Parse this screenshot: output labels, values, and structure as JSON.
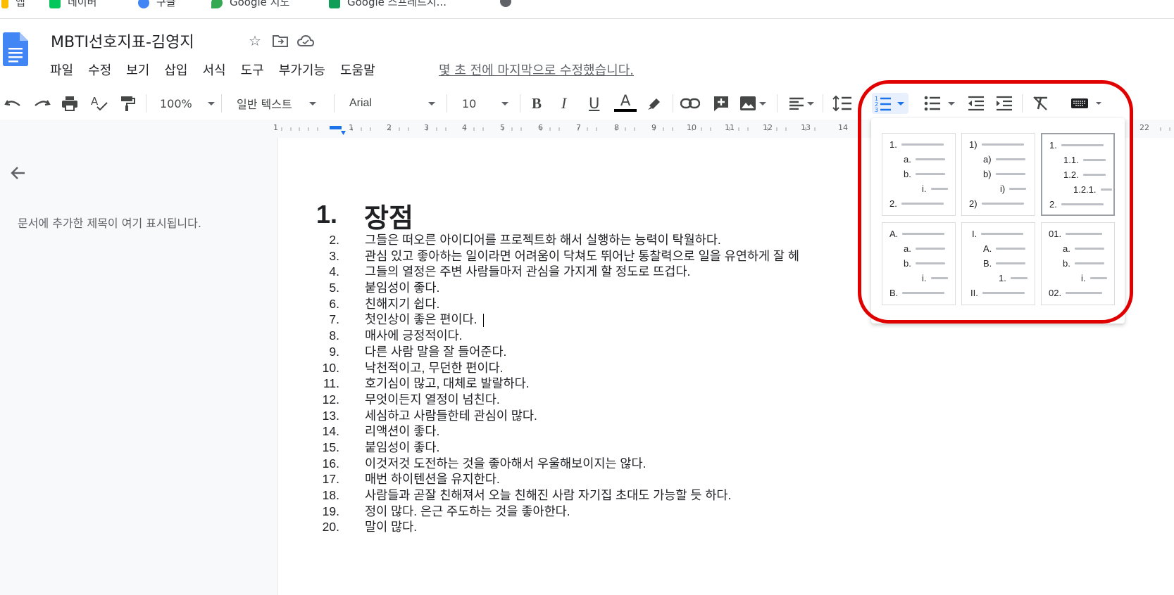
{
  "bookmarks": [
    {
      "label": "앱",
      "color": "#fbbc04"
    },
    {
      "label": "네이버",
      "color": "#03c75a"
    },
    {
      "label": "구글",
      "color": "#4285f4"
    },
    {
      "label": "Google 지도",
      "color": "#34a853"
    },
    {
      "label": "Google 스프레드시...",
      "color": "#0f9d58"
    }
  ],
  "header": {
    "title": "MBTI선호지표-김영지",
    "menu": [
      "파일",
      "수정",
      "보기",
      "삽입",
      "서식",
      "도구",
      "부가기능",
      "도움말"
    ],
    "last_edit": "몇 초 전에 마지막으로 수정했습니다."
  },
  "toolbar": {
    "zoom": "100%",
    "style": "일반 텍스트",
    "font": "Arial",
    "size": "10",
    "text_color": "#000000",
    "accent": "#1a73e8"
  },
  "ruler": {
    "numbers": [
      "1",
      "1",
      "2",
      "3",
      "4",
      "5",
      "6",
      "7",
      "8",
      "9",
      "10",
      "11",
      "12",
      "13",
      "14",
      "22"
    ]
  },
  "sidebar": {
    "hint": "문서에 추가한 제목이 여기 표시됩니다."
  },
  "document": {
    "heading_number": "1.",
    "heading": "장점",
    "items": [
      {
        "n": "2.",
        "t": "그들은 떠오른 아이디어를 프로젝트화 해서 실행하는 능력이 탁월하다."
      },
      {
        "n": "3.",
        "t": "관심 있고 좋아하는 일이라면 어려움이 닥쳐도 뛰어난 통찰력으로 일을 유연하게 잘 헤"
      },
      {
        "n": "4.",
        "t": "그들의 열정은 주변 사람들마저 관심을 가지게 할 정도로 뜨겁다."
      },
      {
        "n": "5.",
        "t": "붙임성이 좋다."
      },
      {
        "n": "6.",
        "t": "친해지기 쉽다."
      },
      {
        "n": "7.",
        "t": "첫인상이 좋은 편이다."
      },
      {
        "n": "8.",
        "t": "매사에 긍정적이다."
      },
      {
        "n": "9.",
        "t": "다른 사람 말을 잘 들어준다."
      },
      {
        "n": "10.",
        "t": "낙천적이고, 무던한 편이다."
      },
      {
        "n": "11.",
        "t": "호기심이 많고, 대체로 발랄하다."
      },
      {
        "n": "12.",
        "t": "무엇이든지 열정이 넘친다."
      },
      {
        "n": "13.",
        "t": "세심하고 사람들한테 관심이 많다."
      },
      {
        "n": "14.",
        "t": "리액션이 좋다."
      },
      {
        "n": "15.",
        "t": "붙임성이 좋다."
      },
      {
        "n": "16.",
        "t": "이것저것 도전하는 것을 좋아해서 우울해보이지는 않다."
      },
      {
        "n": "17.",
        "t": "매번 하이텐션을 유지한다."
      },
      {
        "n": "18.",
        "t": "사람들과 곧잘 친해져서 오늘 친해진 사람 자기집 초대도 가능할 듯 하다."
      },
      {
        "n": "19.",
        "t": "정이 많다. 은근 주도하는 것을 좋아한다."
      },
      {
        "n": "20.",
        "t": "말이 많다."
      }
    ]
  },
  "list_presets": [
    {
      "rows": [
        "1.",
        "a.",
        "b.",
        "i.",
        "2."
      ],
      "selected": false
    },
    {
      "rows": [
        "1)",
        "a)",
        "b)",
        "i)",
        "2)"
      ],
      "selected": false
    },
    {
      "rows": [
        "1.",
        "1.1.",
        "1.2.",
        "1.2.1.",
        "2."
      ],
      "selected": true
    },
    {
      "rows": [
        "A.",
        "a.",
        "b.",
        "i.",
        "B."
      ],
      "selected": false
    },
    {
      "rows": [
        "I.",
        "A.",
        "B.",
        "1.",
        "II."
      ],
      "selected": false
    },
    {
      "rows": [
        "01.",
        "a.",
        "b.",
        "i.",
        "02."
      ],
      "selected": false
    }
  ],
  "annotation_color": "#e00000"
}
